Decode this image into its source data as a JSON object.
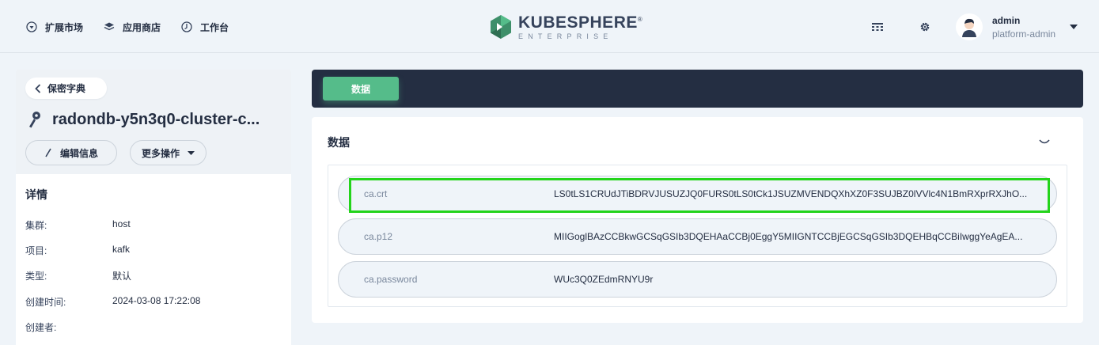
{
  "topnav": {
    "items": [
      {
        "label": "扩展市场",
        "icon": "extensions-icon"
      },
      {
        "label": "应用商店",
        "icon": "app-store-icon"
      },
      {
        "label": "工作台",
        "icon": "workbench-icon"
      }
    ],
    "logo": {
      "main": "KUBESPHERE",
      "sub": "ENTERPRISE",
      "mark": "®"
    },
    "user": {
      "name": "admin",
      "role": "platform-admin"
    }
  },
  "sidebar": {
    "back_label": "保密字典",
    "resource_name": "radondb-y5n3q0-cluster-c...",
    "edit_label": "编辑信息",
    "more_label": "更多操作",
    "details_title": "详情",
    "details": [
      {
        "label": "集群:",
        "value": "host"
      },
      {
        "label": "项目:",
        "value": "kafk"
      },
      {
        "label": "类型:",
        "value": "默认"
      },
      {
        "label": "创建时间:",
        "value": "2024-03-08 17:22:08"
      },
      {
        "label": "创建者:",
        "value": ""
      }
    ]
  },
  "main": {
    "tab_label": "数据",
    "card_title": "数据",
    "rows": [
      {
        "key": "ca.crt",
        "value": "LS0tLS1CRUdJTiBDRVJUSUZJQ0FURS0tLS0tCk1JSUZMVENDQXhXZ0F3SUJBZ0lVVlc4N1BmRXprRXJhO..."
      },
      {
        "key": "ca.p12",
        "value": "MIIGoglBAzCCBkwGCSqGSIb3DQEHAaCCBj0EggY5MIIGNTCCBjEGCSqGSIb3DQEHBqCCBiIwggYeAgEA..."
      },
      {
        "key": "ca.password",
        "value": "WUc3Q0ZEdmRNYU9r"
      }
    ]
  },
  "colors": {
    "accent": "#55bc8a",
    "dark": "#242e42",
    "highlight": "#24d41b",
    "background": "#eff4f9"
  }
}
